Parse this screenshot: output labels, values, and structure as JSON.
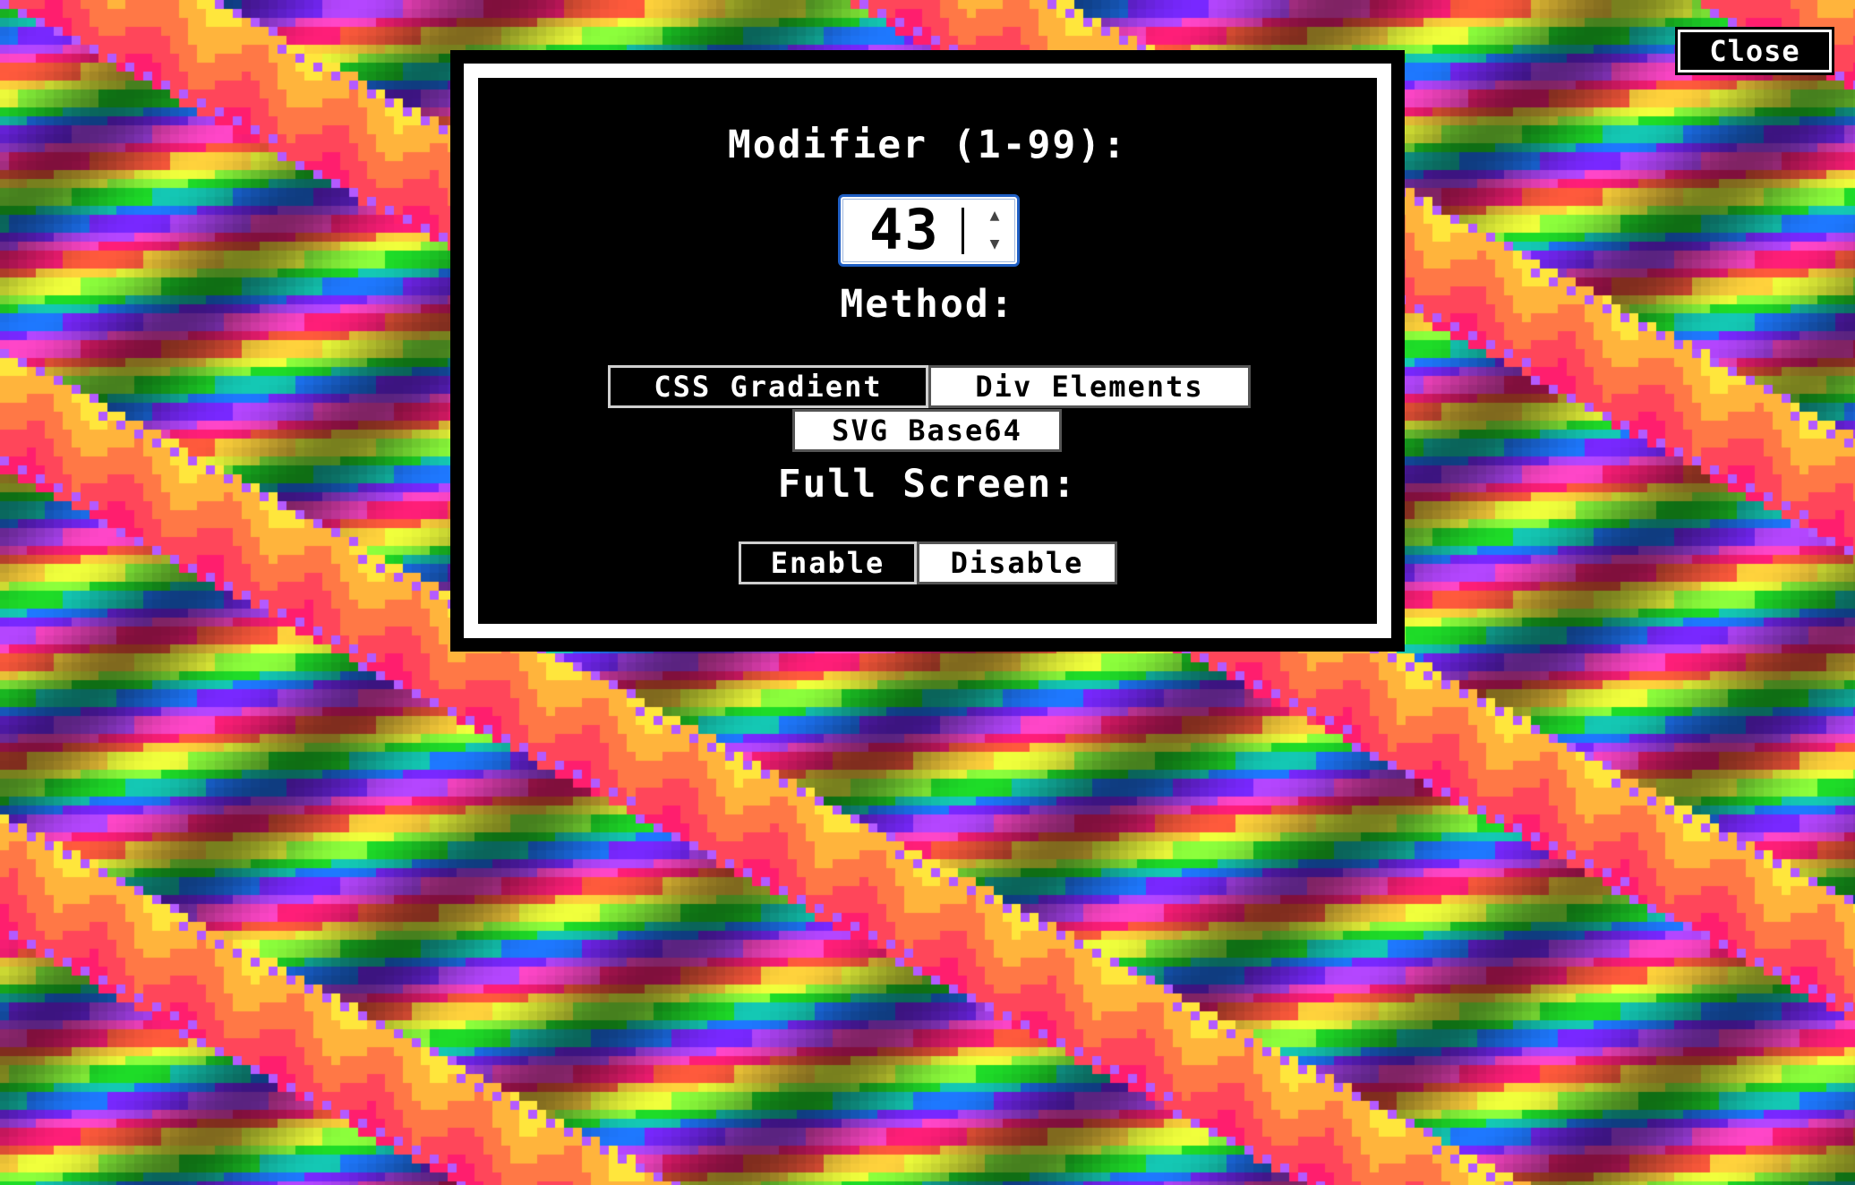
{
  "toolbar": {
    "close_label": "Close"
  },
  "settings": {
    "modifier_label": "Modifier (1-99):",
    "modifier_value": "43",
    "method_label": "Method:",
    "methods": [
      "CSS Gradient",
      "Div Elements",
      "SVG Base64"
    ],
    "selected_method": "CSS Gradient",
    "fullscreen_label": "Full Screen:",
    "fullscreen_options": [
      "Enable",
      "Disable"
    ],
    "selected_fullscreen": "Enable"
  },
  "colors": {
    "background_palette": [
      "#ff1e78",
      "#ff5a3c",
      "#ffd23c",
      "#f0ff3c",
      "#8cff3c",
      "#1edc28",
      "#14c8b4",
      "#1e78ff",
      "#7828ff",
      "#b446ff",
      "#ff46c8"
    ],
    "focus_ring": "#1f5fc4"
  }
}
